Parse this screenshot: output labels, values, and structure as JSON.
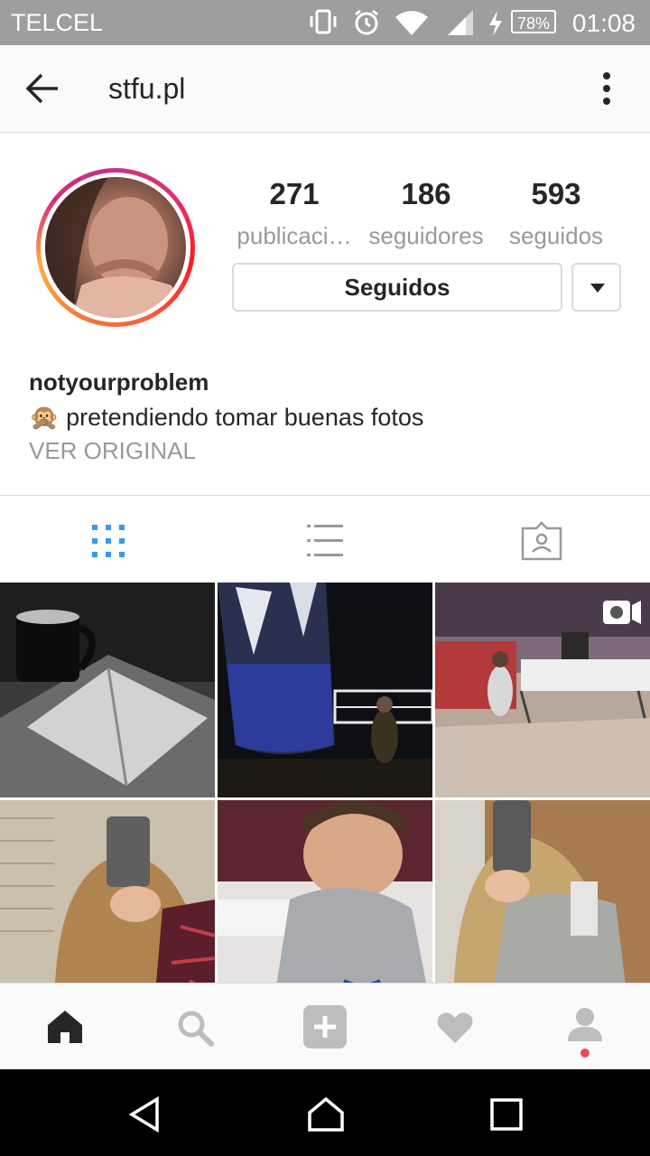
{
  "status_bar": {
    "carrier": "TELCEL",
    "battery": "78%",
    "time": "01:08"
  },
  "header": {
    "title": "stfu.pl"
  },
  "profile": {
    "stats": [
      {
        "value": "271",
        "label": "publicaci…"
      },
      {
        "value": "186",
        "label": "seguidores"
      },
      {
        "value": "593",
        "label": "seguidos"
      }
    ],
    "follow_button": "Seguidos",
    "username": "notyourproblem",
    "bio": "🙊 pretendiendo tomar buenas fotos",
    "see_original": "VER ORIGINAL"
  },
  "tabs": [
    {
      "icon": "grid-icon",
      "active": true
    },
    {
      "icon": "list-icon",
      "active": false
    },
    {
      "icon": "tagged-icon",
      "active": false
    }
  ],
  "grid_items": [
    {
      "desc_icon": "photo",
      "has_video_badge": false
    },
    {
      "desc_icon": "photo",
      "has_video_badge": false
    },
    {
      "desc_icon": "photo",
      "has_video_badge": true
    },
    {
      "desc_icon": "photo",
      "has_video_badge": false
    },
    {
      "desc_icon": "photo",
      "has_video_badge": false
    },
    {
      "desc_icon": "photo",
      "has_video_badge": false
    }
  ],
  "bottom_nav": [
    "home-icon",
    "search-icon",
    "add-post-icon",
    "activity-heart-icon",
    "profile-icon"
  ],
  "colors": {
    "accent_blue": "#3897f0",
    "notification_red": "#ed4956",
    "ring_start": "#c13584",
    "ring_end": "#fcaf45"
  }
}
